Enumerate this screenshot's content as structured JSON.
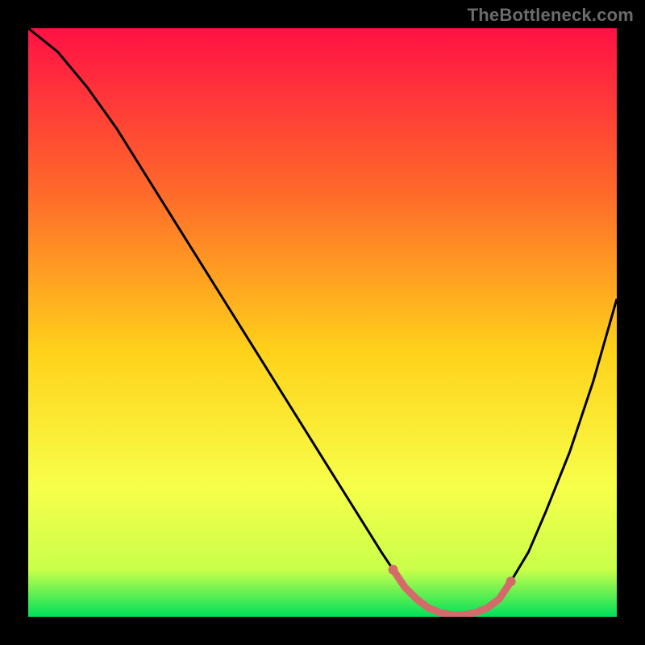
{
  "attribution": "TheBottleneck.com",
  "colors": {
    "gradient_stops": [
      "#ff1144",
      "#ff6a2a",
      "#ffd21a",
      "#f7ff4a",
      "#c9ff4a",
      "#00e05a"
    ],
    "curve_stroke": "#000000",
    "marker_stroke": "#d46a6a",
    "marker_fill": "#d46a6a"
  },
  "chart_data": {
    "type": "line",
    "title": "",
    "xlabel": "",
    "ylabel": "",
    "xlim": [
      0,
      100
    ],
    "ylim": [
      0,
      100
    ],
    "grid": false,
    "legend": false,
    "x": [
      0,
      5,
      10,
      15,
      20,
      25,
      30,
      35,
      40,
      45,
      50,
      55,
      60,
      62,
      64,
      66,
      68,
      70,
      72,
      74,
      76,
      78,
      80,
      82,
      85,
      88,
      92,
      96,
      100
    ],
    "values": [
      100,
      96,
      90,
      83,
      75,
      67,
      59,
      51,
      43,
      35,
      27,
      19,
      11,
      8,
      5,
      3,
      1.5,
      0.7,
      0.3,
      0.3,
      0.7,
      1.5,
      3,
      6,
      11,
      18,
      28,
      40,
      54
    ],
    "marker_region": {
      "x": [
        62,
        64,
        66,
        68,
        70,
        72,
        74,
        76,
        78,
        80,
        82
      ],
      "values": [
        8,
        5,
        3,
        1.5,
        0.7,
        0.3,
        0.3,
        0.7,
        1.5,
        3,
        6
      ]
    },
    "annotations": []
  }
}
